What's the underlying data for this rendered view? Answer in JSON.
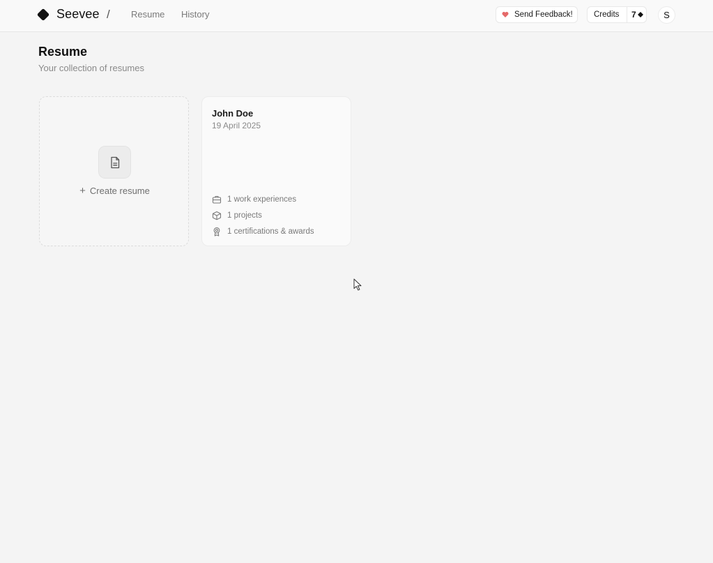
{
  "brand": {
    "name": "Seevee",
    "separator": "/"
  },
  "nav": {
    "resume": "Resume",
    "history": "History"
  },
  "header": {
    "feedback_label": "Send Feedback!",
    "credits_label": "Credits",
    "credits_count": "7",
    "avatar_initial": "S"
  },
  "page": {
    "title": "Resume",
    "subtitle": "Your collection of resumes"
  },
  "create_card": {
    "plus": "+",
    "label": "Create resume"
  },
  "resumes": [
    {
      "name": "John Doe",
      "date": "19 April 2025",
      "stats": {
        "work": "1 work experiences",
        "projects": "1 projects",
        "certs": "1 certifications & awards"
      }
    }
  ],
  "icons": {
    "logo": "diamond-logo-icon",
    "feedback": "heart-icon",
    "credits": "diamond-icon",
    "create": "file-text-icon",
    "work": "briefcase-icon",
    "projects": "box-icon",
    "certs": "award-icon"
  },
  "colors": {
    "heart": "#e56a6a",
    "accent": "#111111"
  }
}
